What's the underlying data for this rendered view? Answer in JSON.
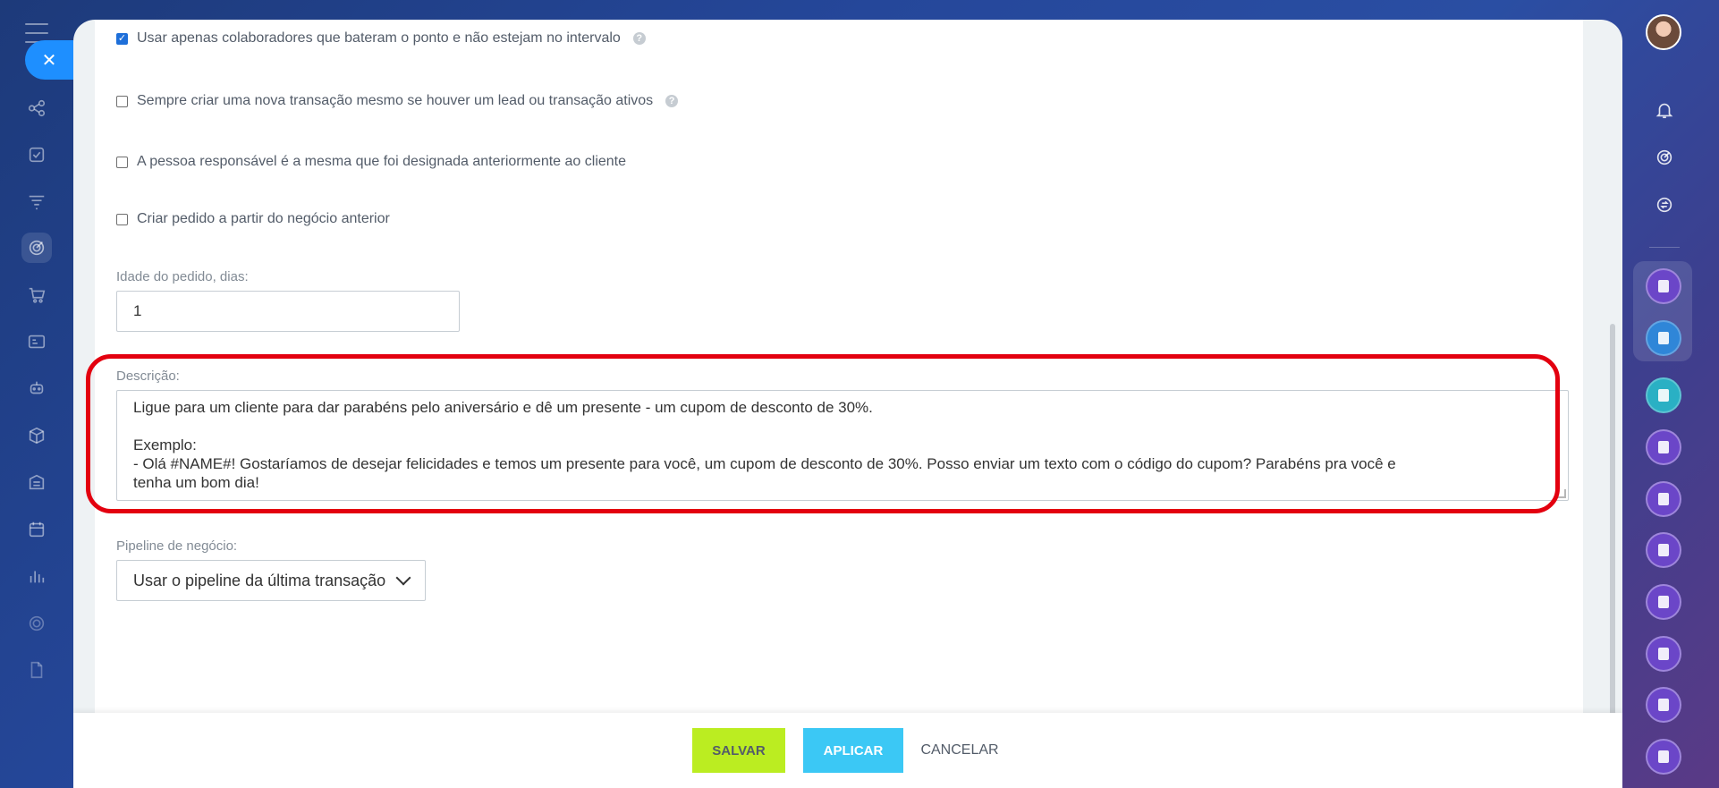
{
  "checkboxes": [
    {
      "label": "Usar apenas colaboradores que bateram o ponto e não estejam no intervalo",
      "checked": true,
      "help": true
    },
    {
      "label": "Sempre criar uma nova transação mesmo se houver um lead ou transação ativos",
      "checked": false,
      "help": true
    },
    {
      "label": "A pessoa responsável é a mesma que foi designada anteriormente ao cliente",
      "checked": false,
      "help": false
    },
    {
      "label": "Criar pedido a partir do negócio anterior",
      "checked": false,
      "help": false
    }
  ],
  "order_age": {
    "label": "Idade do pedido, dias:",
    "value": "1"
  },
  "description": {
    "label": "Descrição:",
    "lines": [
      "Ligue para um cliente para dar parabéns pelo aniversário e dê um presente - um cupom de desconto de 30%.",
      "",
      "Exemplo:",
      "- Olá #NAME#! Gostaríamos de desejar felicidades e temos um presente para você, um cupom de desconto de 30%. Posso enviar um texto com o código do cupom? Parabéns pra você e",
      "tenha um bom dia!"
    ]
  },
  "pipeline": {
    "label": "Pipeline de negócio:",
    "selected": "Usar o pipeline da última transação"
  },
  "footer": {
    "save": "SALVAR",
    "apply": "APLICAR",
    "cancel": "CANCELAR"
  },
  "colors": {
    "save_bg": "#bbed21",
    "apply_bg": "#3bc8f5",
    "highlight": "#e3000f",
    "close_bg": "#1e8fff"
  },
  "left_sidebar_icons": [
    "menu-icon",
    "close-icon",
    "share-nodes-icon",
    "task-check-icon",
    "filter-funnel-icon",
    "target-icon",
    "cart-icon",
    "id-card-icon",
    "robot-icon",
    "box-icon",
    "building-icon",
    "calendar-icon",
    "bar-chart-icon",
    "shield-icon",
    "document-icon"
  ],
  "right_sidebar_icons": [
    "avatar",
    "bell-icon",
    "target-icon",
    "chat-sync-icon",
    "app-icon",
    "bookmark-icon",
    "chat-bubble-icon"
  ]
}
